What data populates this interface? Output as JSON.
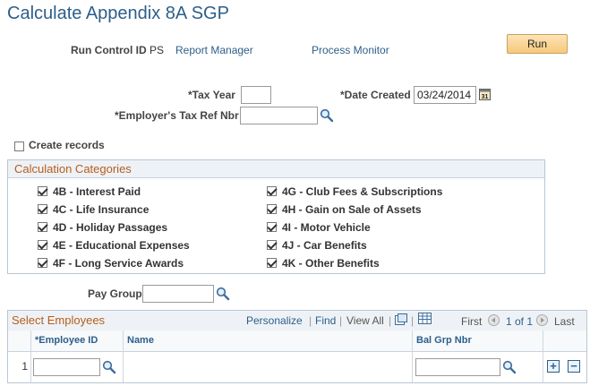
{
  "page": {
    "title": "Calculate Appendix 8A SGP"
  },
  "header": {
    "run_control_label": "Run Control ID",
    "run_control_value": "PS",
    "report_manager": "Report Manager",
    "process_monitor": "Process Monitor",
    "run_button": "Run"
  },
  "form": {
    "tax_year_label": "*Tax Year",
    "tax_year_value": "",
    "date_created_label": "*Date Created",
    "date_created_value": "03/24/2014",
    "employer_ref_label": "*Employer's Tax Ref Nbr",
    "employer_ref_value": "",
    "create_records_label": "Create records",
    "create_records_checked": false,
    "pay_group_label": "Pay Group",
    "pay_group_value": ""
  },
  "calculation_categories": {
    "title": "Calculation Categories",
    "left": [
      {
        "label": "4B - Interest Paid",
        "checked": true
      },
      {
        "label": "4C - Life Insurance",
        "checked": true
      },
      {
        "label": "4D - Holiday Passages",
        "checked": true
      },
      {
        "label": "4E - Educational Expenses",
        "checked": true
      },
      {
        "label": "4F - Long Service Awards",
        "checked": true
      }
    ],
    "right": [
      {
        "label": "4G - Club Fees & Subscriptions",
        "checked": true
      },
      {
        "label": "4H - Gain on Sale of Assets",
        "checked": true
      },
      {
        "label": "4I - Motor Vehicle",
        "checked": true
      },
      {
        "label": "4J - Car Benefits",
        "checked": true
      },
      {
        "label": "4K - Other Benefits",
        "checked": true
      }
    ]
  },
  "select_employees": {
    "title": "Select Employees",
    "personalize": "Personalize",
    "find": "Find",
    "view_all": "View All",
    "first": "First",
    "pagination": "1 of 1",
    "last": "Last",
    "columns": {
      "employee_id": "*Employee ID",
      "name": "Name",
      "bal_grp_nbr": "Bal Grp Nbr"
    },
    "rows": [
      {
        "row_num": "1",
        "employee_id": "",
        "name": "",
        "bal_grp_nbr": ""
      }
    ]
  },
  "icons": {
    "lookup": "magnifier-icon",
    "calendar": "calendar-icon",
    "add_row": "plus-icon",
    "delete_row": "minus-icon"
  }
}
